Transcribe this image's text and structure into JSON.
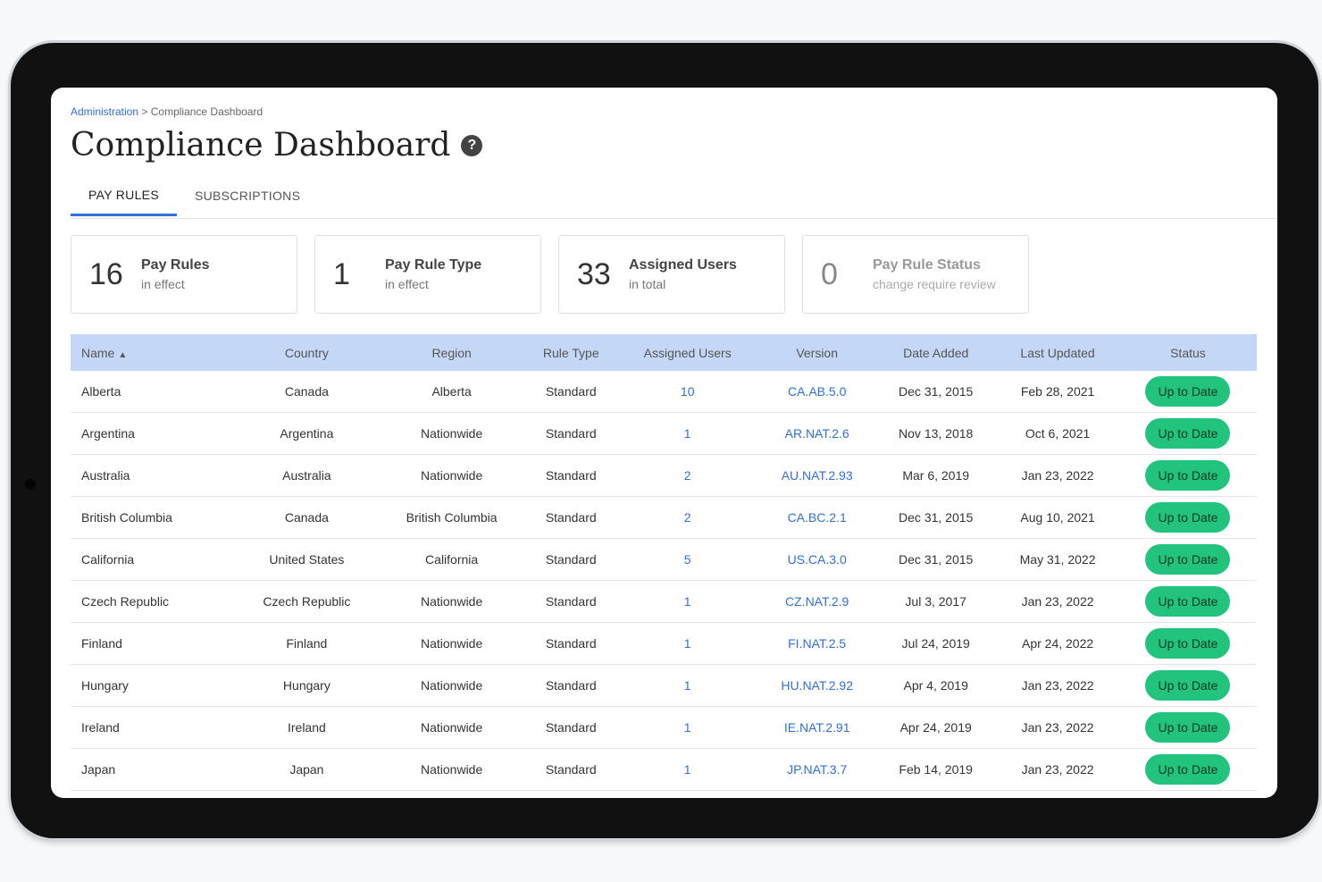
{
  "breadcrumb": {
    "parent": "Administration",
    "separator": ">",
    "current": "Compliance Dashboard"
  },
  "page_title": "Compliance Dashboard",
  "help_icon_glyph": "?",
  "tabs": [
    {
      "label": "PAY RULES",
      "active": true
    },
    {
      "label": "SUBSCRIPTIONS",
      "active": false
    }
  ],
  "cards": [
    {
      "number": "16",
      "label": "Pay Rules",
      "sub": "in effect"
    },
    {
      "number": "1",
      "label": "Pay Rule Type",
      "sub": "in effect"
    },
    {
      "number": "33",
      "label": "Assigned Users",
      "sub": "in total"
    },
    {
      "number": "0",
      "label": "Pay Rule Status",
      "sub": "change require review"
    }
  ],
  "table": {
    "sort_glyph": "▲",
    "headers": [
      "Name",
      "Country",
      "Region",
      "Rule Type",
      "Assigned Users",
      "Version",
      "Date Added",
      "Last Updated",
      "Status"
    ],
    "rows": [
      [
        "Alberta",
        "Canada",
        "Alberta",
        "Standard",
        "10",
        "CA.AB.5.0",
        "Dec 31, 2015",
        "Feb 28, 2021",
        "Up to Date"
      ],
      [
        "Argentina",
        "Argentina",
        "Nationwide",
        "Standard",
        "1",
        "AR.NAT.2.6",
        "Nov 13, 2018",
        "Oct 6, 2021",
        "Up to Date"
      ],
      [
        "Australia",
        "Australia",
        "Nationwide",
        "Standard",
        "2",
        "AU.NAT.2.93",
        "Mar 6, 2019",
        "Jan 23, 2022",
        "Up to Date"
      ],
      [
        "British Columbia",
        "Canada",
        "British Columbia",
        "Standard",
        "2",
        "CA.BC.2.1",
        "Dec 31, 2015",
        "Aug 10, 2021",
        "Up to Date"
      ],
      [
        "California",
        "United States",
        "California",
        "Standard",
        "5",
        "US.CA.3.0",
        "Dec 31, 2015",
        "May 31, 2022",
        "Up to Date"
      ],
      [
        "Czech Republic",
        "Czech Republic",
        "Nationwide",
        "Standard",
        "1",
        "CZ.NAT.2.9",
        "Jul 3, 2017",
        "Jan 23, 2022",
        "Up to Date"
      ],
      [
        "Finland",
        "Finland",
        "Nationwide",
        "Standard",
        "1",
        "FI.NAT.2.5",
        "Jul 24, 2019",
        "Apr 24, 2022",
        "Up to Date"
      ],
      [
        "Hungary",
        "Hungary",
        "Nationwide",
        "Standard",
        "1",
        "HU.NAT.2.92",
        "Apr 4, 2019",
        "Jan 23, 2022",
        "Up to Date"
      ],
      [
        "Ireland",
        "Ireland",
        "Nationwide",
        "Standard",
        "1",
        "IE.NAT.2.91",
        "Apr 24, 2019",
        "Jan 23, 2022",
        "Up to Date"
      ],
      [
        "Japan",
        "Japan",
        "Nationwide",
        "Standard",
        "1",
        "JP.NAT.3.7",
        "Feb 14, 2019",
        "Jan 23, 2022",
        "Up to Date"
      ]
    ]
  },
  "colors": {
    "accent": "#2f6fd6",
    "header_bg": "#c5d7f7",
    "status_green": "#22c37c"
  }
}
